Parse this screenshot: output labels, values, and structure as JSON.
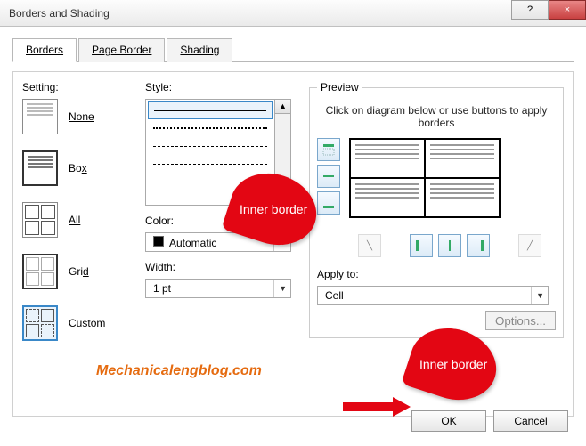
{
  "window": {
    "title": "Borders and Shading",
    "help_tooltip": "?",
    "close_tooltip": "×"
  },
  "tabs": {
    "borders": "Borders",
    "page_border": "Page Border",
    "shading": "Shading"
  },
  "labels": {
    "setting": "Setting:",
    "style": "Style:",
    "color": "Color:",
    "width": "Width:",
    "preview": "Preview",
    "preview_hint": "Click on diagram below or use buttons to apply borders",
    "apply_to": "Apply to:",
    "options": "Options..."
  },
  "settings": {
    "none": "None",
    "box": "Box",
    "all": "All",
    "grid": "Grid",
    "custom": "Custom"
  },
  "color_combo": {
    "value": "Automatic"
  },
  "width_combo": {
    "value": "1 pt"
  },
  "apply_combo": {
    "value": "Cell"
  },
  "footer": {
    "ok": "OK",
    "cancel": "Cancel"
  },
  "annotations": {
    "balloon1": "Inner border",
    "balloon2": "Inner border",
    "watermark": "Mechanicalengblog.com"
  }
}
